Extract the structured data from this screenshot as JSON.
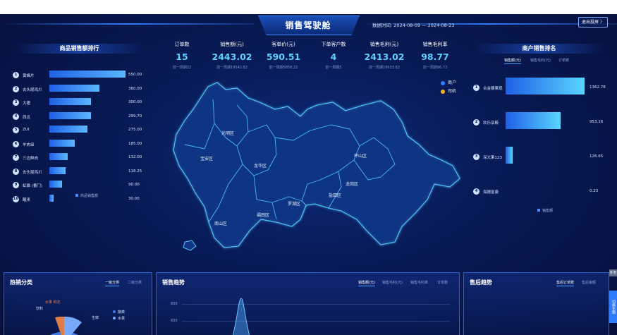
{
  "header": {
    "title": "销售驾驶舱",
    "date_range": "数据时间: 2024-08-09 — 2024-08-23",
    "exit_label": "退出投屏 〉"
  },
  "product_ranking": {
    "title": "商品销售额排行",
    "legend": "商品销售额",
    "items": [
      {
        "rank": "1",
        "name": "黄蜂片",
        "value": 550.0,
        "value_label": "550.00"
      },
      {
        "rank": "2",
        "name": "去头尾鸡爪",
        "value": 360.0,
        "value_label": "360.00"
      },
      {
        "rank": "3",
        "name": "大猪",
        "value": 300.0,
        "value_label": "300.00"
      },
      {
        "rank": "4",
        "name": "西瓜",
        "value": 299.7,
        "value_label": "299.70"
      },
      {
        "rank": "5",
        "name": "ZUI",
        "value": 275.0,
        "value_label": "275.00"
      },
      {
        "rank": "6",
        "name": "羊肉串",
        "value": 185.0,
        "value_label": "185.00"
      },
      {
        "rank": "7",
        "name": "三边鲜肉",
        "value": 132.0,
        "value_label": "132.00"
      },
      {
        "rank": "8",
        "name": "去头尾鸡爪",
        "value": 118.25,
        "value_label": "118.25"
      },
      {
        "rank": "9",
        "name": "虹猫 (番门)",
        "value": 90.0,
        "value_label": "90.00"
      },
      {
        "rank": "10",
        "name": "醒来",
        "value": 30.0,
        "value_label": "30.00"
      }
    ]
  },
  "kpis": [
    {
      "label": "订单数",
      "value": "15",
      "sub": "前一周期22"
    },
    {
      "label": "销售额(元)",
      "value": "2443.02",
      "sub": "前一周期19542.82"
    },
    {
      "label": "客单价(元)",
      "value": "590.51",
      "sub": "前一周期5856.22"
    },
    {
      "label": "下单客户数",
      "value": "4",
      "sub": "前一周期5"
    },
    {
      "label": "销售毛利(元)",
      "value": "2413.02",
      "sub": "前一周期18933.82"
    },
    {
      "label": "销售毛利率",
      "value": "98.77",
      "sub": "前一周期96.73"
    }
  ],
  "map": {
    "legend": [
      "商户",
      "司机"
    ],
    "legend_colors": [
      "#2f7cff",
      "#f2b619"
    ],
    "districts": [
      "光明区",
      "宝安区",
      "龙华区",
      "坪山区",
      "龙岗区",
      "盐田区",
      "罗湖区",
      "福田区",
      "南山区"
    ]
  },
  "merchant_ranking": {
    "title": "商户销售排名",
    "tabs": [
      "销售额(元)",
      "销售毛利(元)",
      "订单数"
    ],
    "legend": "销售额",
    "items": [
      {
        "rank": "1",
        "name": "合金要果观",
        "value": 1362.78,
        "value_label": "1362.78"
      },
      {
        "rank": "2",
        "name": "欢乐享殿",
        "value": 953.16,
        "value_label": "953.16"
      },
      {
        "rank": "3",
        "name": "深大果123",
        "value": 126.65,
        "value_label": "126.65"
      },
      {
        "rank": "4",
        "name": "海德富康",
        "value": 0.23,
        "value_label": "0.23"
      }
    ]
  },
  "bottom": {
    "category": {
      "title": "热销分类",
      "tabs": [
        "一级分类",
        "二级分类"
      ],
      "labels": [
        "水果 鲜花",
        "饮料",
        "生鲜"
      ],
      "legend": [
        "蔬菜",
        "水果"
      ]
    },
    "trend": {
      "title": "销售趋势",
      "tabs": [
        "销售额(元)",
        "销售毛利(元)",
        "销售毛利率",
        "订单数"
      ],
      "y_ticks": [
        "800",
        "600"
      ]
    },
    "aftersale": {
      "title": "售后趋势",
      "tabs": [
        "售后订单数",
        "售后金额"
      ]
    }
  },
  "side": {
    "top_label": "任务",
    "bottom_label": "切换主题"
  }
}
